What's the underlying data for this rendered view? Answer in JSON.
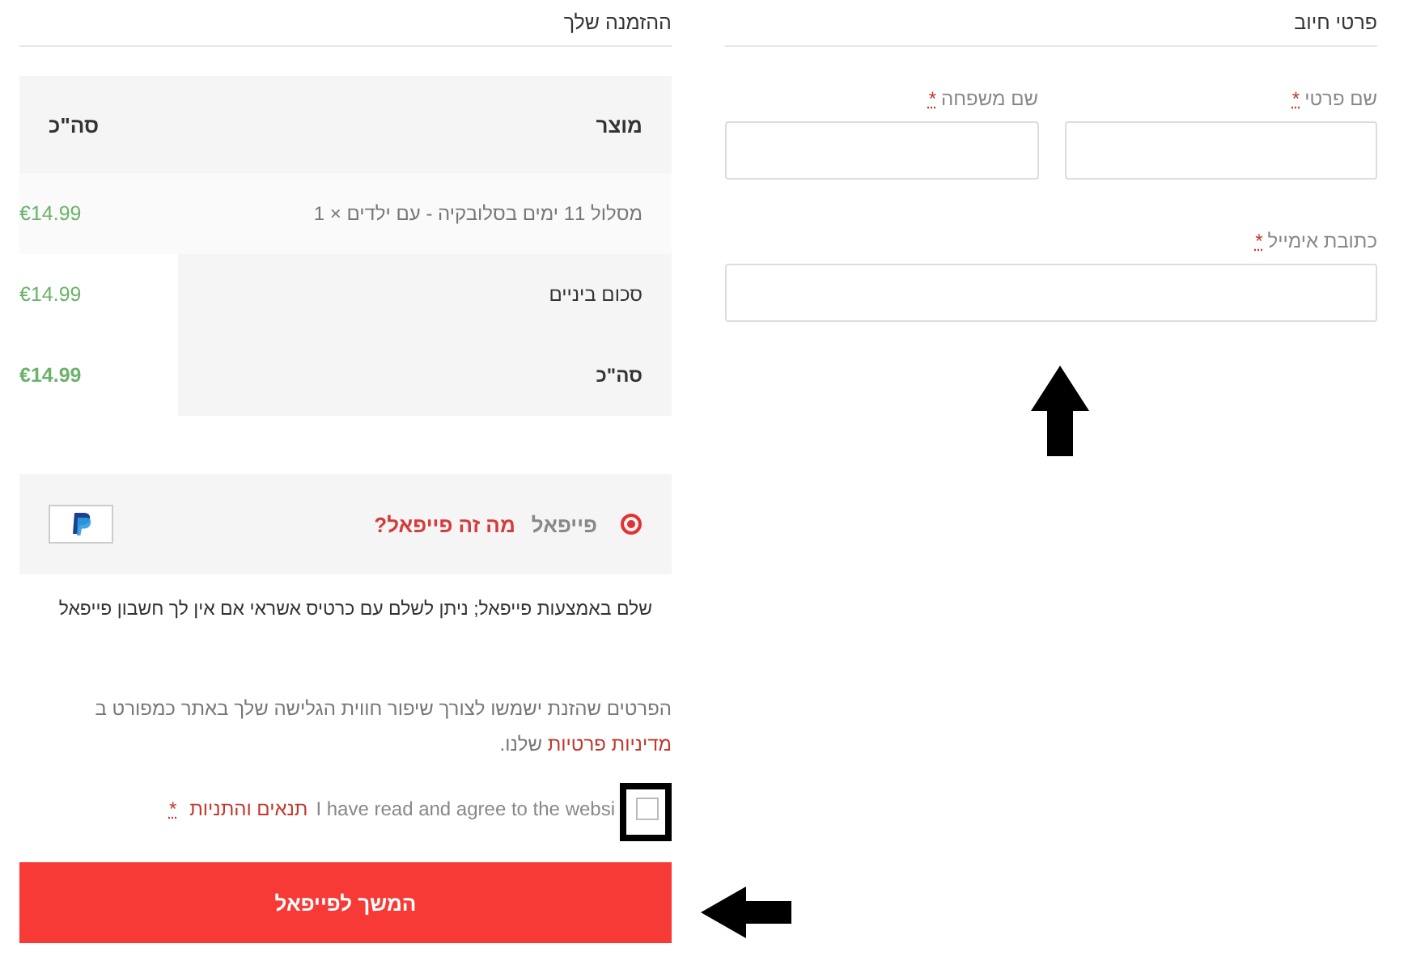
{
  "billing": {
    "title": "פרטי חיוב",
    "fields": [
      {
        "kind": "half",
        "label": "שם פרטי",
        "required_mark": "*"
      },
      {
        "kind": "half",
        "label": "שם משפחה",
        "required_mark": "*"
      },
      {
        "kind": "full",
        "label": "כתובת אימייל",
        "required_mark": "*"
      }
    ]
  },
  "order": {
    "title": "ההזמנה שלך",
    "columns": [
      "מוצר",
      "סה\"כ"
    ],
    "items": [
      {
        "name": "מסלול 11 ימים בסלובקיה - עם ילדים",
        "quantity": "× 1",
        "total": "€14.99"
      }
    ],
    "totals": [
      {
        "kind": "subtotal",
        "label": "סכום ביניים",
        "value": "€14.99"
      },
      {
        "kind": "total",
        "label": "סה\"כ",
        "value": "€14.99"
      }
    ]
  },
  "payment": {
    "methods": [
      {
        "label": "פייפאל",
        "link": "מה זה פייפאל?",
        "selected": true
      }
    ],
    "description": "שלם באמצעות פייפאל; ניתן לשלם עם כרטיס אשראי אם אין לך חשבון פייפאל"
  },
  "privacy": {
    "text": "הפרטים שהזנת ישמשו לצורך שיפור חווית הגלישה שלך באתר כמפורט ב",
    "link": "מדיניות פרטיות",
    "after": " שלנו."
  },
  "terms": {
    "checked": false,
    "text": "I have read and agree to the websi",
    "link": "תנאים והתניות",
    "required_mark": "*"
  },
  "submit_button": "המשך לפייפאל",
  "annotations": [
    {
      "kind": "arrow-up"
    },
    {
      "kind": "arrow-left"
    },
    {
      "kind": "highlight"
    }
  ]
}
